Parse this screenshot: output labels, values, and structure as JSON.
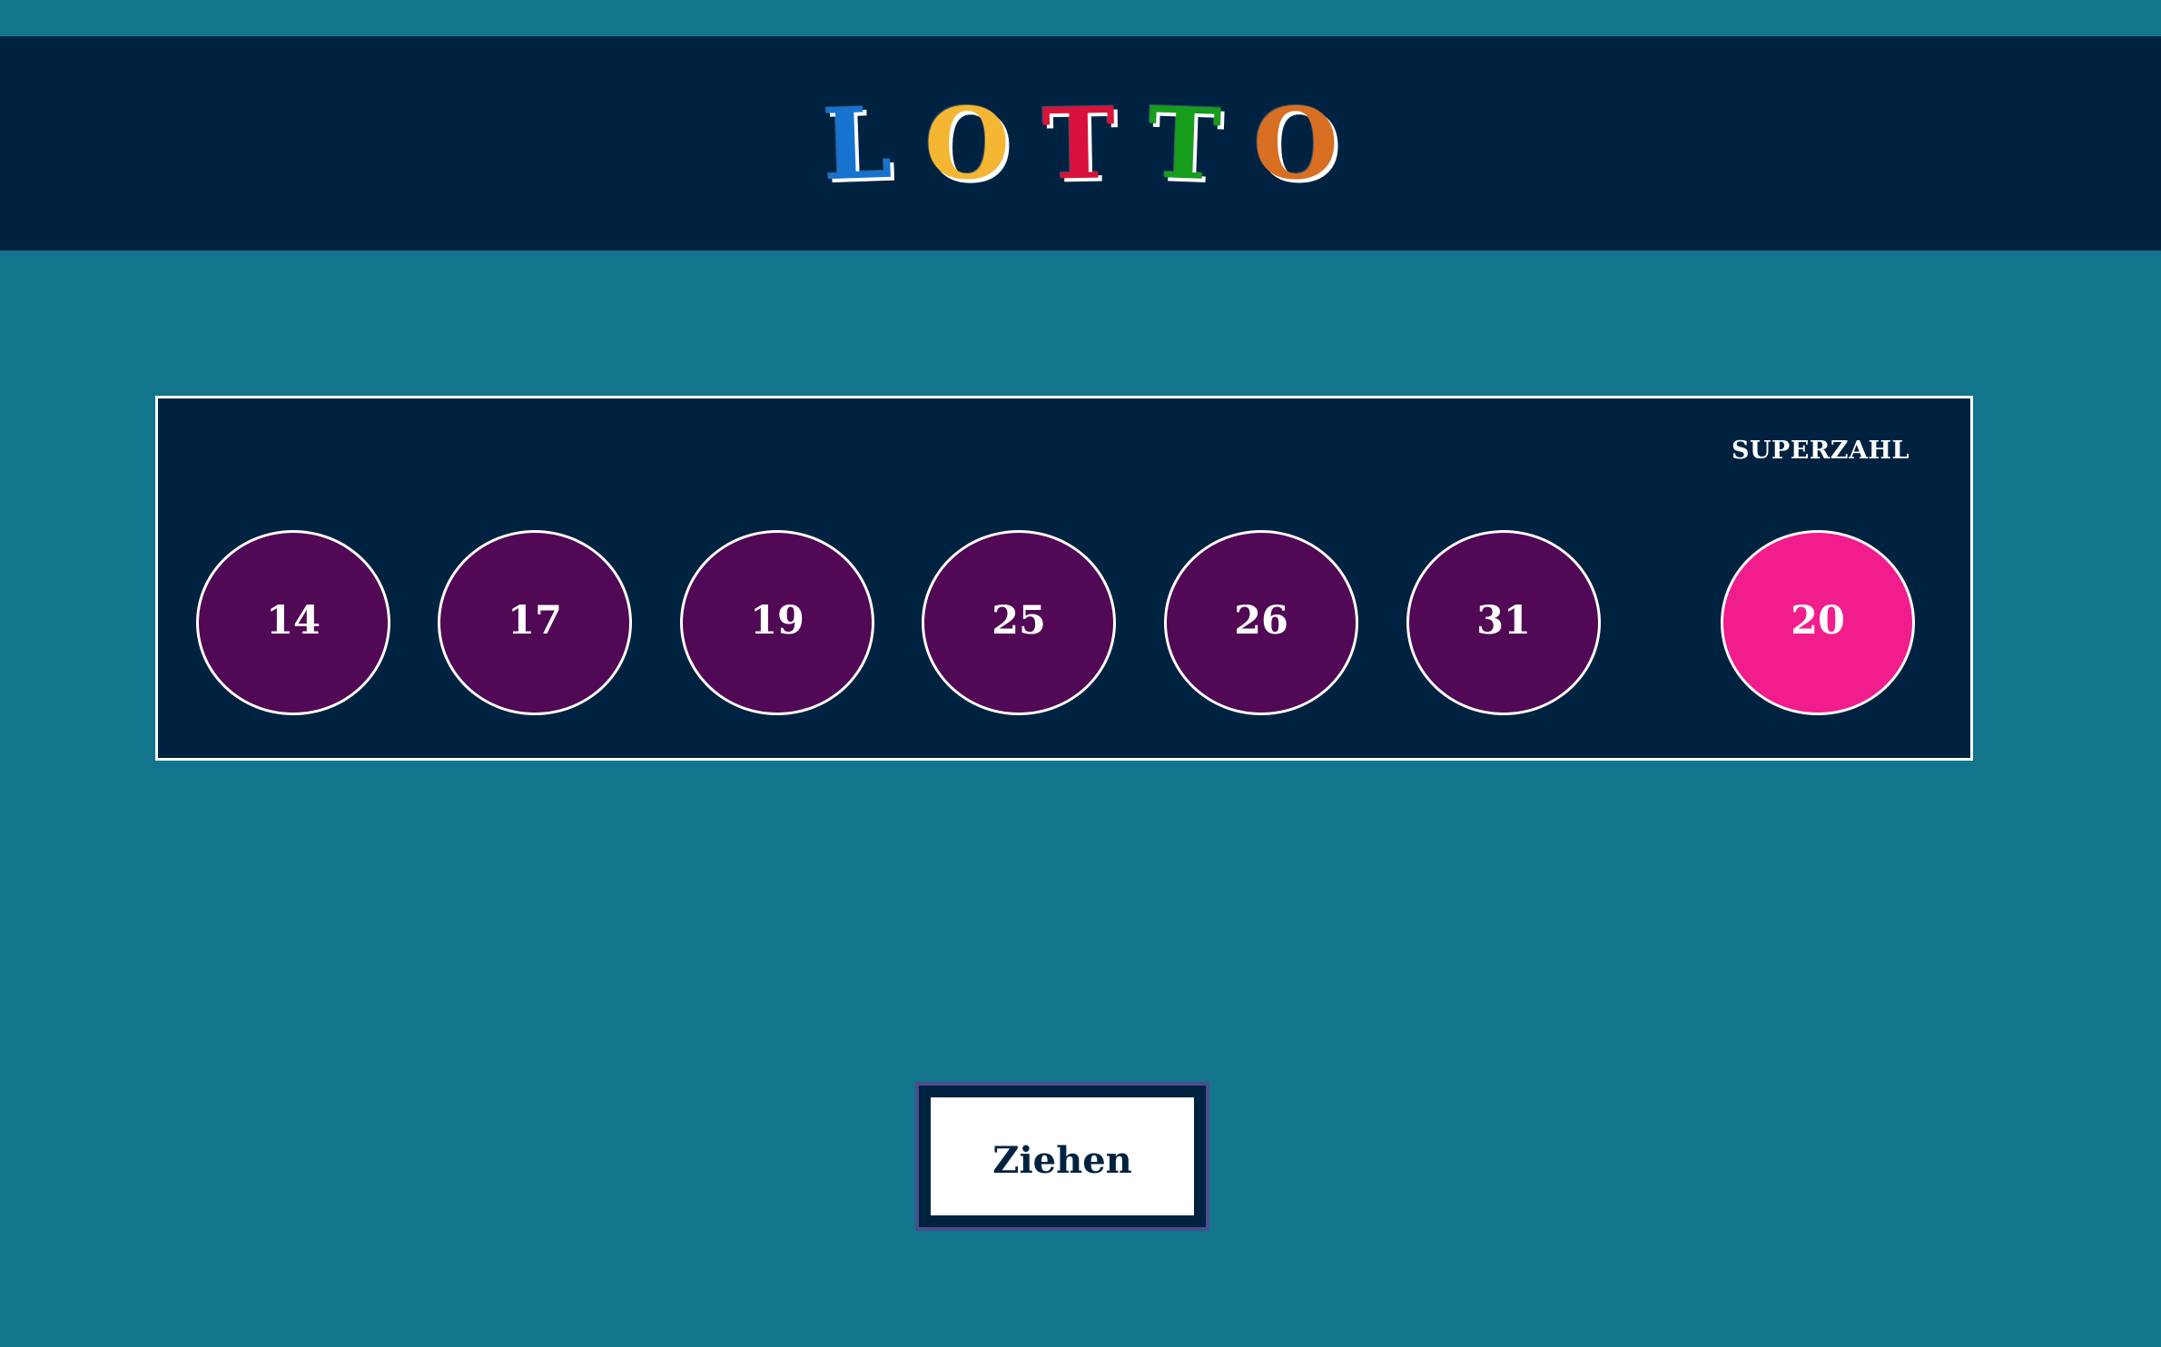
{
  "header": {
    "logo_letters": [
      {
        "text": "L",
        "color": "#1673cf"
      },
      {
        "text": "O",
        "color": "#f4b633"
      },
      {
        "text": "T",
        "color": "#d8123a"
      },
      {
        "text": "T",
        "color": "#169d1b"
      },
      {
        "text": "O",
        "color": "#d86f22"
      }
    ]
  },
  "draw": {
    "superzahl_label": "SUPERZAHL",
    "main_numbers": [
      "14",
      "17",
      "19",
      "25",
      "26",
      "31"
    ],
    "superzahl": "20"
  },
  "actions": {
    "draw_button_label": "Ziehen"
  },
  "colors": {
    "page_background": "#12758b",
    "header_background": "#002241",
    "panel_background": "#002241",
    "ball_color": "#510855",
    "superzahl_color": "#f11d8c",
    "button_text": "#002241",
    "button_outline": "#4b4d8c"
  }
}
